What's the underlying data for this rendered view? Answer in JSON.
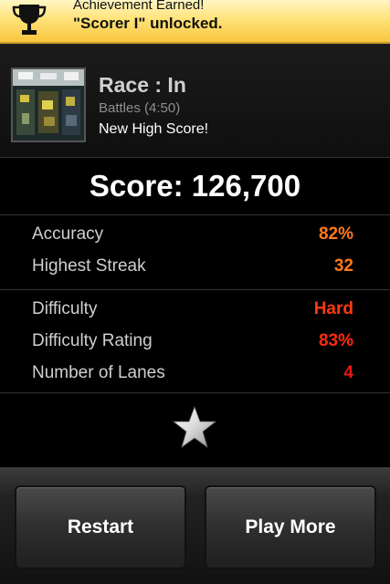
{
  "achievement": {
    "line1": "Achievement Earned!",
    "line2": "\"Scorer I\" unlocked.",
    "icon": "trophy-icon",
    "colors": {
      "bg_top": "#fff6c4",
      "bg_bottom": "#f8c63c"
    }
  },
  "song": {
    "title": "Race : In",
    "subtitle": "Battles (4:50)",
    "status": "New High Score!"
  },
  "score": {
    "text": "Score: 126,700"
  },
  "stats_group1": [
    {
      "label": "Accuracy",
      "value": "82%",
      "color": "#ff7a1a"
    },
    {
      "label": "Highest Streak",
      "value": "32",
      "color": "#ff7a1a"
    }
  ],
  "stats_group2": [
    {
      "label": "Difficulty",
      "value": "Hard",
      "color": "#ff3a12"
    },
    {
      "label": "Difficulty Rating",
      "value": "83%",
      "color": "#ff2a10"
    },
    {
      "label": "Number of Lanes",
      "value": "4",
      "color": "#e81818"
    }
  ],
  "rating": {
    "stars": 1,
    "icon": "star-icon"
  },
  "buttons": {
    "restart": "Restart",
    "play_more": "Play More"
  }
}
